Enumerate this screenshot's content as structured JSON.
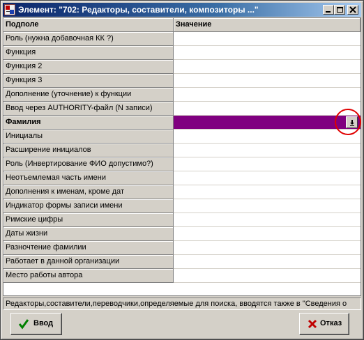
{
  "window": {
    "title": "Элемент: \"702: Редакторы, составители, композиторы ...\""
  },
  "grid": {
    "headers": {
      "field": "Подполе",
      "value": "Значение"
    },
    "rows": [
      {
        "field": "Роль (нужна добавочная КК ?)",
        "value": ""
      },
      {
        "field": "Функция",
        "value": ""
      },
      {
        "field": "Функция 2",
        "value": ""
      },
      {
        "field": "Функция 3",
        "value": ""
      },
      {
        "field": "Дополнение (уточнение) к функции",
        "value": ""
      },
      {
        "field": "Ввод через AUTHORITY-файл (N записи)",
        "value": ""
      },
      {
        "field": "Фамилия",
        "value": "",
        "selected": true
      },
      {
        "field": "Инициалы",
        "value": ""
      },
      {
        "field": "Расширение инициалов",
        "value": ""
      },
      {
        "field": "Роль (Инвертирование ФИО допустимо?)",
        "value": ""
      },
      {
        "field": "Неотъемлемая часть имени",
        "value": ""
      },
      {
        "field": "Дополнения к именам, кроме дат",
        "value": ""
      },
      {
        "field": "Индикатор формы записи имени",
        "value": ""
      },
      {
        "field": "Римские цифры",
        "value": ""
      },
      {
        "field": "Даты жизни",
        "value": ""
      },
      {
        "field": "Разночтение фамилии",
        "value": ""
      },
      {
        "field": "Работает в данной организации",
        "value": ""
      },
      {
        "field": "Место работы автора",
        "value": ""
      }
    ]
  },
  "status": {
    "hint": "Редакторы,составители,переводчики,определяемые для поиска, вводятся также в \"Сведения о"
  },
  "buttons": {
    "ok": "Ввод",
    "cancel": "Отказ"
  },
  "icons": {
    "app": "app-icon",
    "dropdown": "dropdown-arrow-icon",
    "ok": "checkmark-icon",
    "cancel": "cross-icon"
  },
  "colors": {
    "selected_row": "#800080",
    "highlight_ring": "#e00000",
    "ok_check": "#008000",
    "cancel_cross": "#c00000"
  }
}
